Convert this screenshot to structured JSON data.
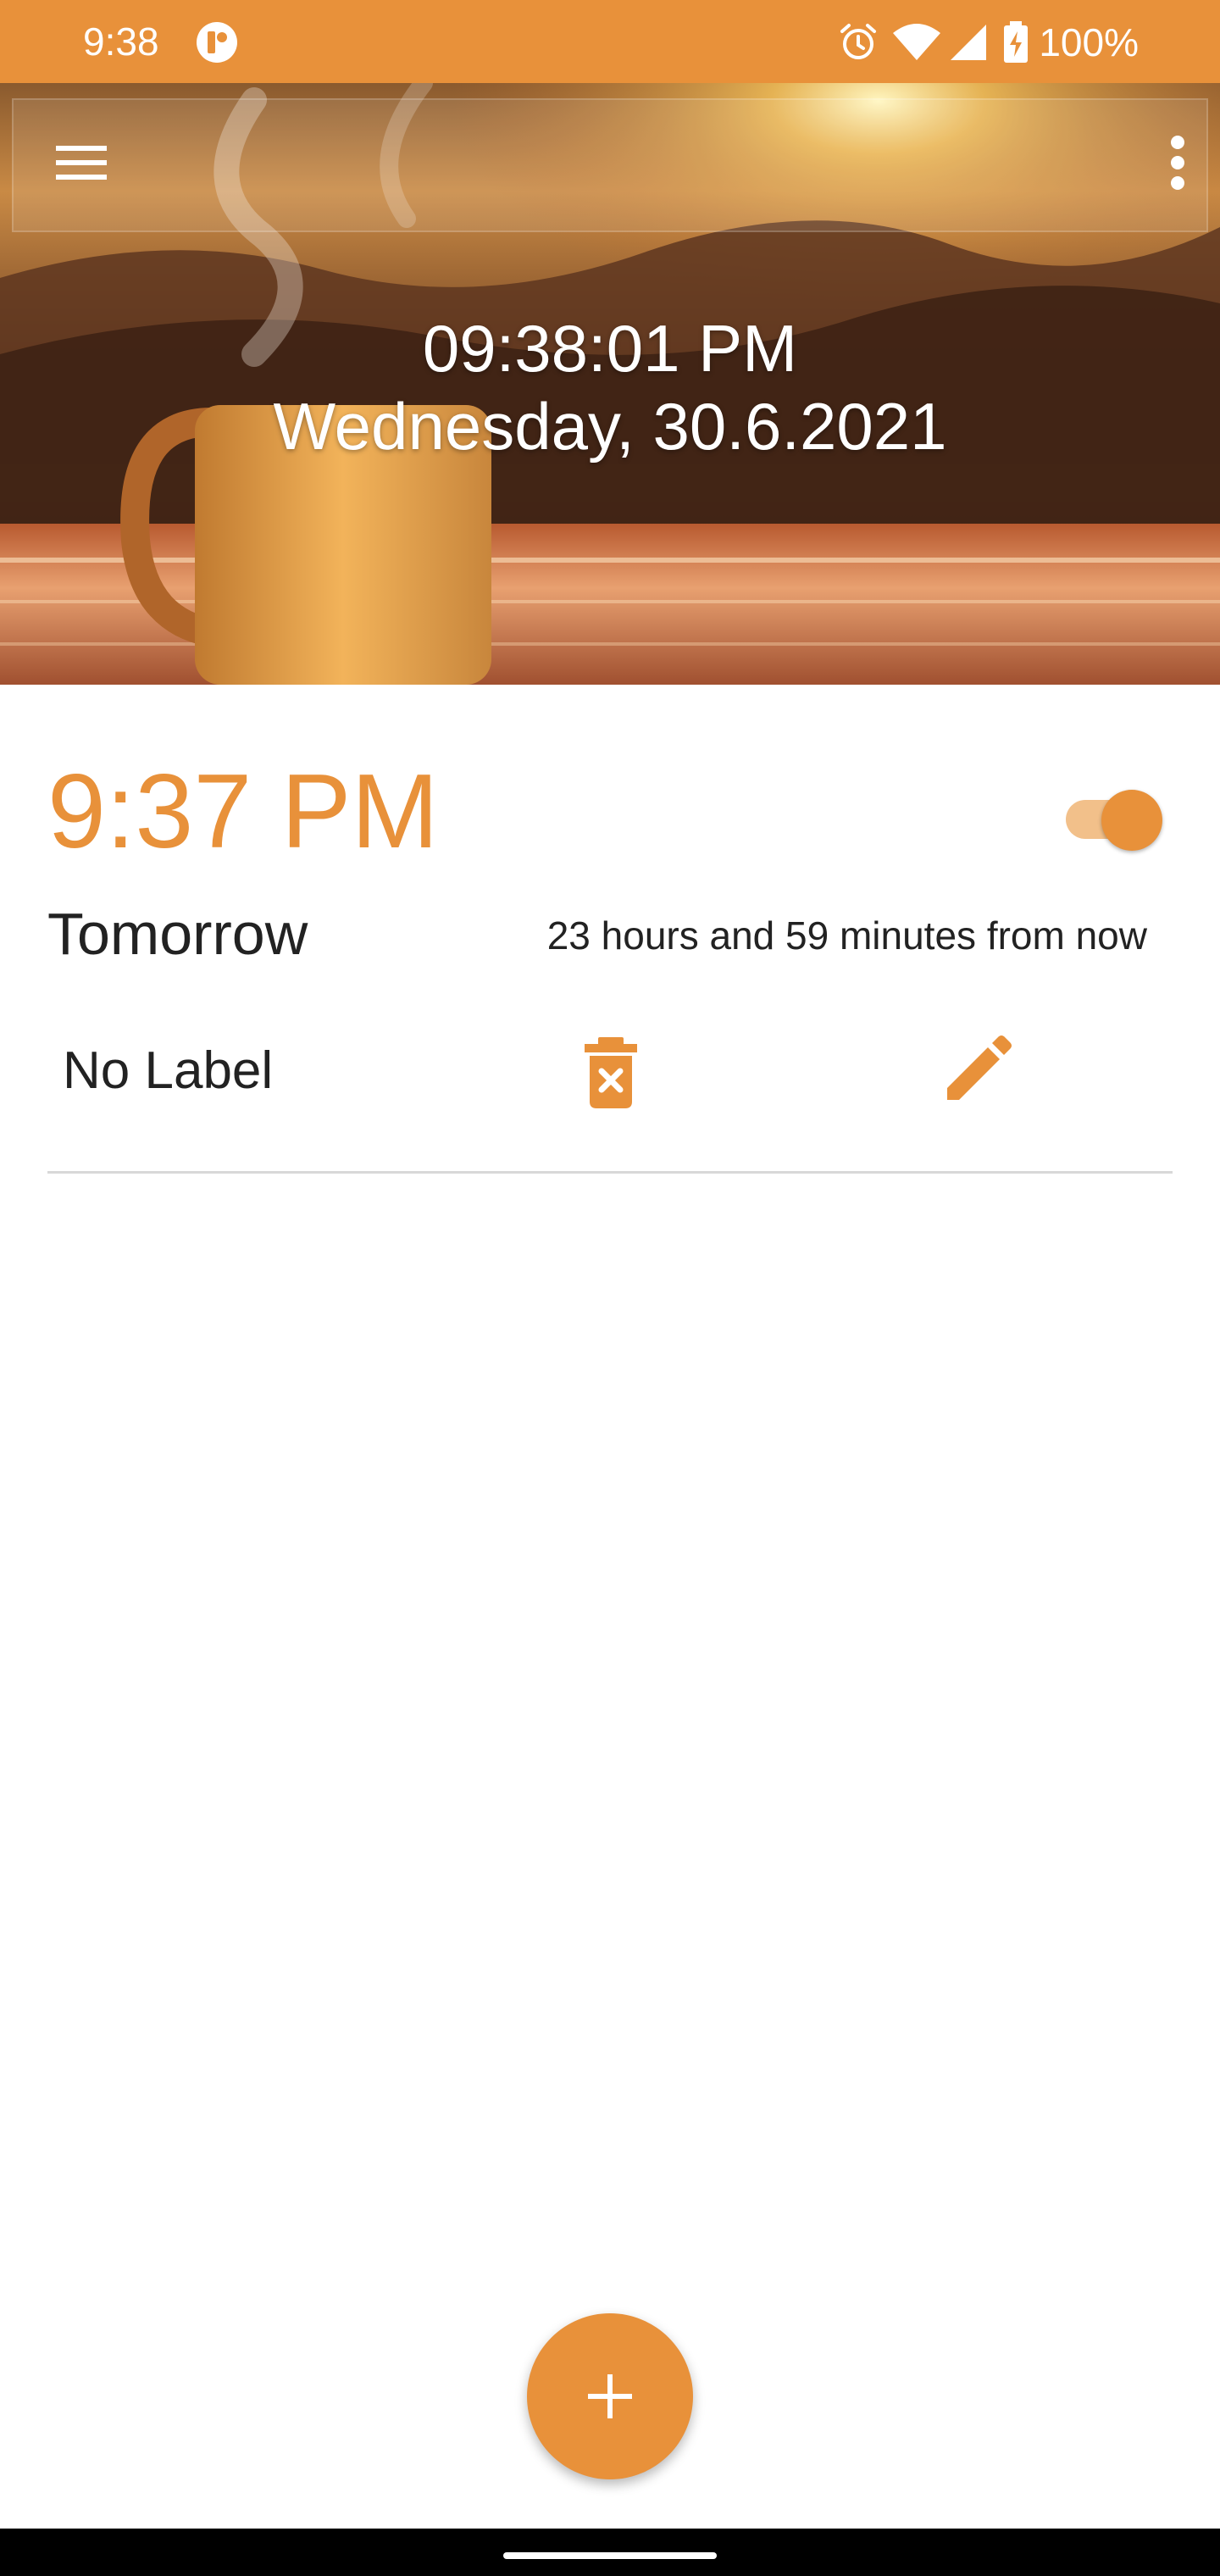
{
  "colors": {
    "accent": "#E8913A",
    "accent_light": "#F2C08A",
    "text_dark": "#222222",
    "divider": "#d8d8d8"
  },
  "status_bar": {
    "time": "9:38",
    "battery": "100%",
    "icons": [
      "app-notification-icon",
      "alarm-icon",
      "wifi-icon",
      "cellular-signal-icon",
      "battery-charging-icon"
    ]
  },
  "header": {
    "clock_time": "09:38:01 PM",
    "clock_date": "Wednesday, 30.6.2021",
    "icons": [
      "menu-icon",
      "more-vert-icon"
    ]
  },
  "alarm": {
    "time": "9:37 PM",
    "enabled": true,
    "day": "Tomorrow",
    "remaining": "23 hours and 59 minutes from now",
    "label": "No Label",
    "icons": [
      "delete-icon",
      "edit-icon"
    ]
  },
  "fab": {
    "icon": "plus-icon"
  }
}
